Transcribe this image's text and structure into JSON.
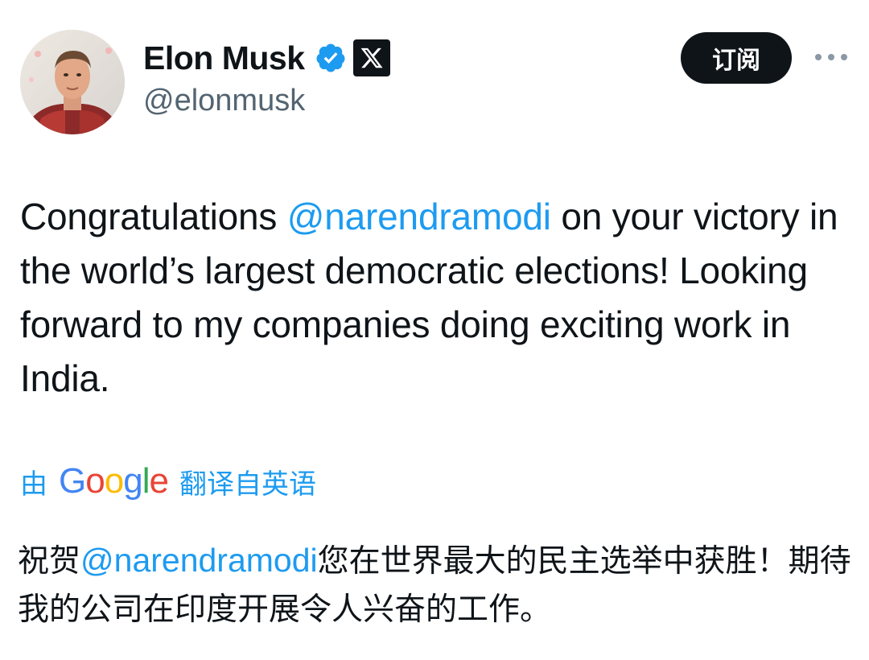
{
  "user": {
    "display_name": "Elon Musk",
    "handle": "@elonmusk",
    "avatar_icon": "profile-photo",
    "verified_icon": "verified-badge-icon",
    "affiliation_icon": "x-logo-icon"
  },
  "actions": {
    "subscribe_label": "订阅",
    "more_icon": "more-options-icon"
  },
  "tweet": {
    "text_before": "Congratulations ",
    "mention": "@narendramodi",
    "text_after": " on your victory in the world’s largest democratic elections! Looking forward to my companies doing exciting work in India."
  },
  "translation": {
    "prefix": "由",
    "provider": "Google",
    "suffix": "翻译自英语",
    "text_before": "祝贺",
    "mention": "@narendramodi",
    "text_after": "您在世界最大的民主选举中获胜！期待我的公司在印度开展令人兴奋的工作。"
  },
  "colors": {
    "accent": "#1d9bf0",
    "text": "#0f1419",
    "secondary_text": "#536471",
    "button_bg": "#0f1419"
  }
}
